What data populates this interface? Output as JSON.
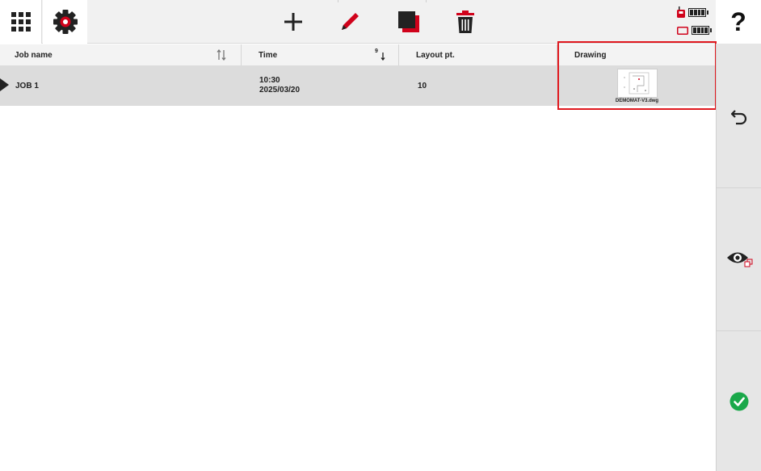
{
  "toolbar": {
    "apps_icon": "grid-icon",
    "settings_icon": "gear-icon",
    "add_icon": "plus-icon",
    "edit_icon": "pencil-icon",
    "copy_icon": "copy-icon",
    "delete_icon": "trash-icon"
  },
  "status": {
    "device_icon": "radio-controller-icon",
    "device_battery_icon": "battery-icon",
    "tablet_icon": "tablet-icon",
    "tablet_battery_icon": "battery-icon"
  },
  "help": {
    "label": "?"
  },
  "table": {
    "columns": [
      {
        "label": "Job name"
      },
      {
        "label": "Time"
      },
      {
        "label": "Layout pt."
      },
      {
        "label": "Drawing"
      }
    ],
    "time_sort_digit": "9",
    "rows": [
      {
        "job_name": "JOB 1",
        "time": "10:30",
        "date": "2025/03/20",
        "layout_pt": "10",
        "drawing_file": "DEMOMAT-V3.dwg"
      }
    ]
  },
  "sidebar": {
    "undo_icon": "undo-icon",
    "view_icon": "eye-icon",
    "confirm_icon": "check-circle-icon"
  },
  "colors": {
    "accent": "#d0021b",
    "confirm": "#1aa84a",
    "highlight_box": "#e0191f",
    "selected_row": "#dcdcdc"
  }
}
